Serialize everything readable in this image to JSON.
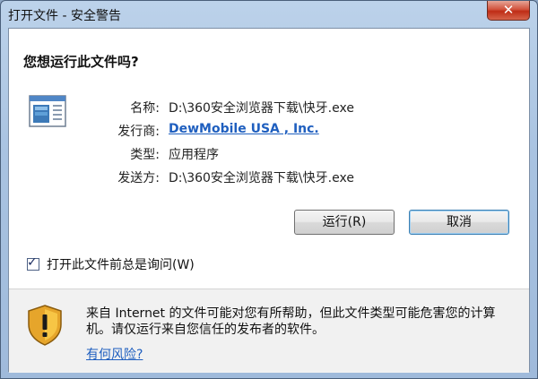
{
  "window": {
    "title": "打开文件 - 安全警告",
    "close_glyph": "✕"
  },
  "question": "您想运行此文件吗?",
  "file_icon": "executable-file-icon",
  "fields": [
    {
      "label": "名称:",
      "value": "D:\\360安全浏览器下载\\快牙.exe"
    },
    {
      "label": "发行商:",
      "value": "DewMobile USA , Inc."
    },
    {
      "label": "类型:",
      "value": "应用程序"
    },
    {
      "label": "发送方:",
      "value": "D:\\360安全浏览器下载\\快牙.exe"
    }
  ],
  "buttons": {
    "run": "运行(R)",
    "cancel": "取消"
  },
  "checkbox": {
    "label": "打开此文件前总是询问(W)",
    "checked": true
  },
  "footer": {
    "icon": "warning-shield-icon",
    "text": "来自 Internet 的文件可能对您有所帮助，但此文件类型可能危害您的计算机。请仅运行来自您信任的发布者的软件。",
    "link": "有何风险?"
  },
  "colors": {
    "link": "#1f5fbf",
    "title_gradient_top": "#bcd2ea",
    "close_button": "#c8391f"
  }
}
